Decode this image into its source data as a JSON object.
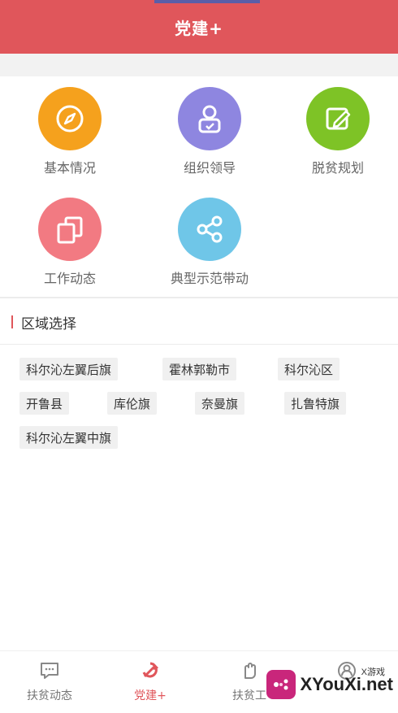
{
  "header": {
    "title": "党建+"
  },
  "tiles": [
    {
      "label": "基本情况",
      "icon": "compass-icon",
      "color": "#f5a11d"
    },
    {
      "label": "组织领导",
      "icon": "user-badge-icon",
      "color": "#8e86e0"
    },
    {
      "label": "脱贫规划",
      "icon": "edit-icon",
      "color": "#7ec326"
    },
    {
      "label": "工作动态",
      "icon": "copy-icon",
      "color": "#f27a82"
    },
    {
      "label": "典型示范带动",
      "icon": "share-icon",
      "color": "#6fc6e8"
    }
  ],
  "region": {
    "title": "区域选择",
    "chips": [
      "科尔沁左翼后旗",
      "霍林郭勒市",
      "科尔沁区",
      "开鲁县",
      "库伦旗",
      "奈曼旗",
      "扎鲁特旗",
      "科尔沁左翼中旗"
    ]
  },
  "tabbar": {
    "tabs": [
      {
        "label": "扶贫动态",
        "icon": "message-icon"
      },
      {
        "label": "党建+",
        "icon": "party-emblem-icon"
      },
      {
        "label": "扶贫工",
        "icon": "hand-icon"
      },
      {
        "label": "",
        "icon": "profile-icon"
      }
    ],
    "active": "党建+"
  },
  "watermark": {
    "text": "XYouXi.net",
    "small": "X游戏"
  }
}
